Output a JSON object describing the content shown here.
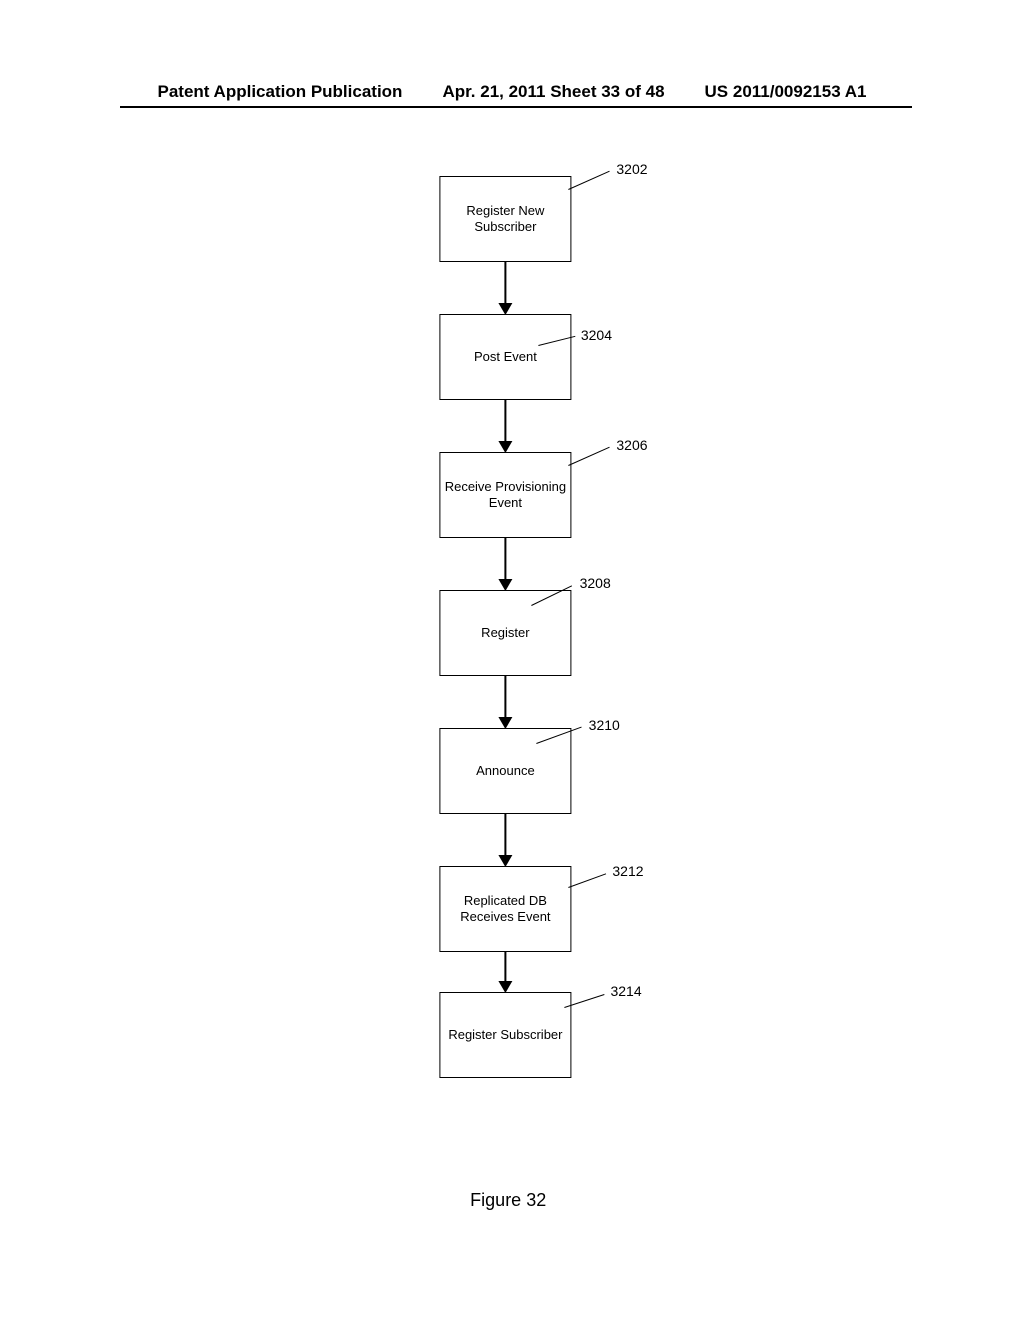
{
  "header": {
    "left": "Patent Application Publication",
    "mid": "Apr. 21, 2011  Sheet 33 of 48",
    "right": "US 2011/0092153 A1"
  },
  "chart_data": {
    "type": "flowchart",
    "direction": "top-to-bottom",
    "nodes": [
      {
        "id": "3202",
        "label": "Register New Subscriber",
        "ref": "3202"
      },
      {
        "id": "3204",
        "label": "Post Event",
        "ref": "3204"
      },
      {
        "id": "3206",
        "label": "Receive Provisioning Event",
        "ref": "3206"
      },
      {
        "id": "3208",
        "label": "Register",
        "ref": "3208"
      },
      {
        "id": "3210",
        "label": "Announce",
        "ref": "3210"
      },
      {
        "id": "3212",
        "label": "Replicated DB Receives Event",
        "ref": "3212"
      },
      {
        "id": "3214",
        "label": "Register Subscriber",
        "ref": "3214"
      }
    ],
    "edges": [
      {
        "from": "3202",
        "to": "3204"
      },
      {
        "from": "3204",
        "to": "3206"
      },
      {
        "from": "3206",
        "to": "3208"
      },
      {
        "from": "3208",
        "to": "3210"
      },
      {
        "from": "3210",
        "to": "3212"
      },
      {
        "from": "3212",
        "to": "3214"
      }
    ]
  },
  "caption": "Figure 32"
}
